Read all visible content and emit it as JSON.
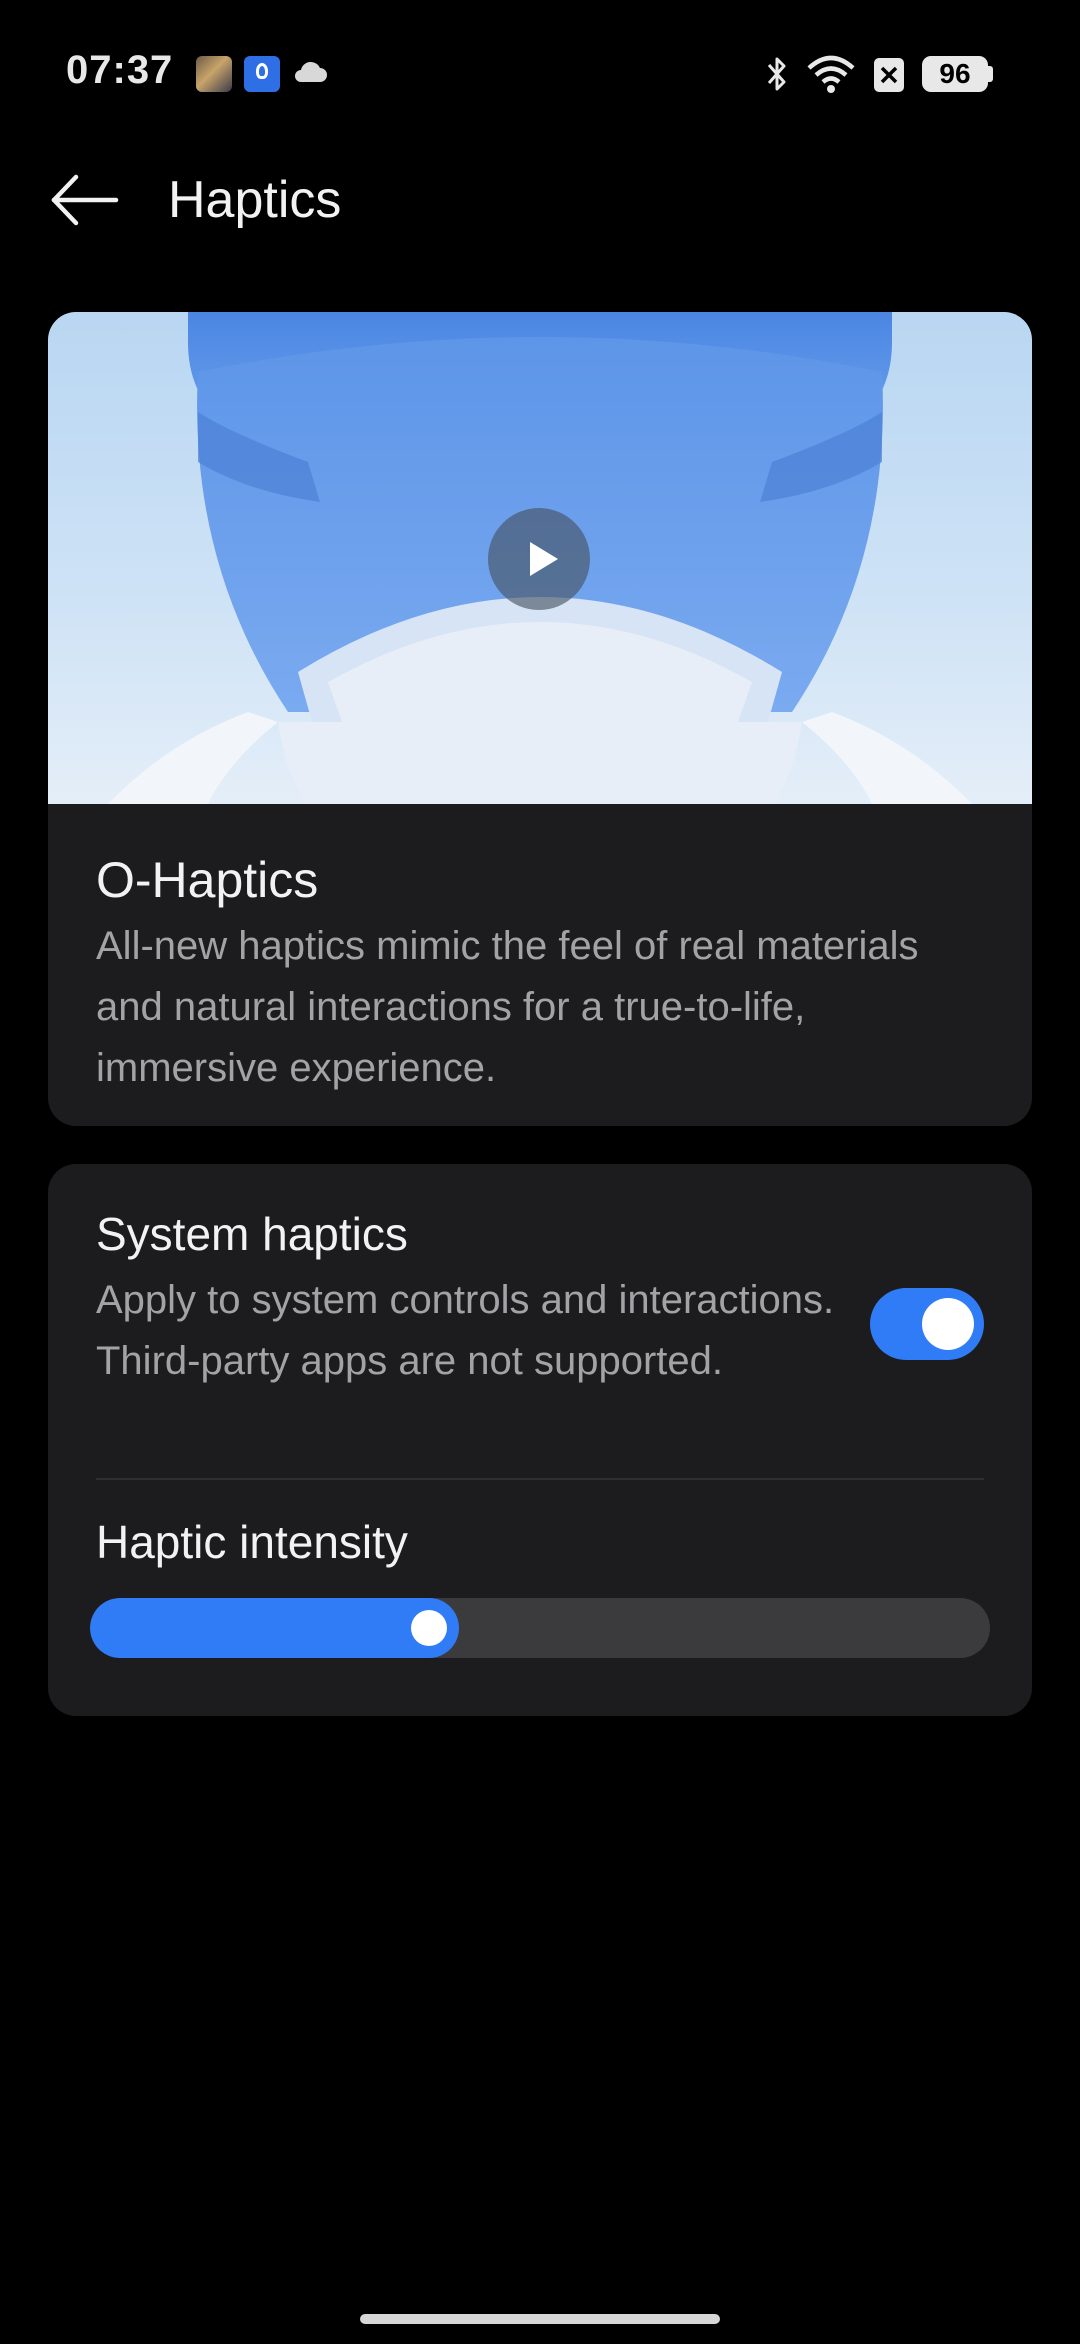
{
  "status_bar": {
    "time": "07:37",
    "battery": "96",
    "icons": [
      "game-app-icon",
      "bulb-app-icon",
      "cloud-icon",
      "bluetooth-icon",
      "wifi-icon",
      "sim-icon",
      "battery-icon"
    ]
  },
  "header": {
    "title": "Haptics",
    "back_icon": "arrow-left-icon"
  },
  "hero_card": {
    "title": "O-Haptics",
    "description": "All-new haptics mimic the feel of real materials and natural interactions for a true-to-life, immersive experience.",
    "play_icon": "play-icon"
  },
  "settings": {
    "system_haptics": {
      "title": "System haptics",
      "description": "Apply to system controls and interactions. Third-party apps are not supported.",
      "enabled": true
    },
    "haptic_intensity": {
      "title": "Haptic intensity",
      "value_fraction": 0.41
    }
  },
  "colors": {
    "accent": "#2f7cf6",
    "background": "#000000",
    "card": "#1c1c1e",
    "secondary_text": "#a3a3a6"
  }
}
